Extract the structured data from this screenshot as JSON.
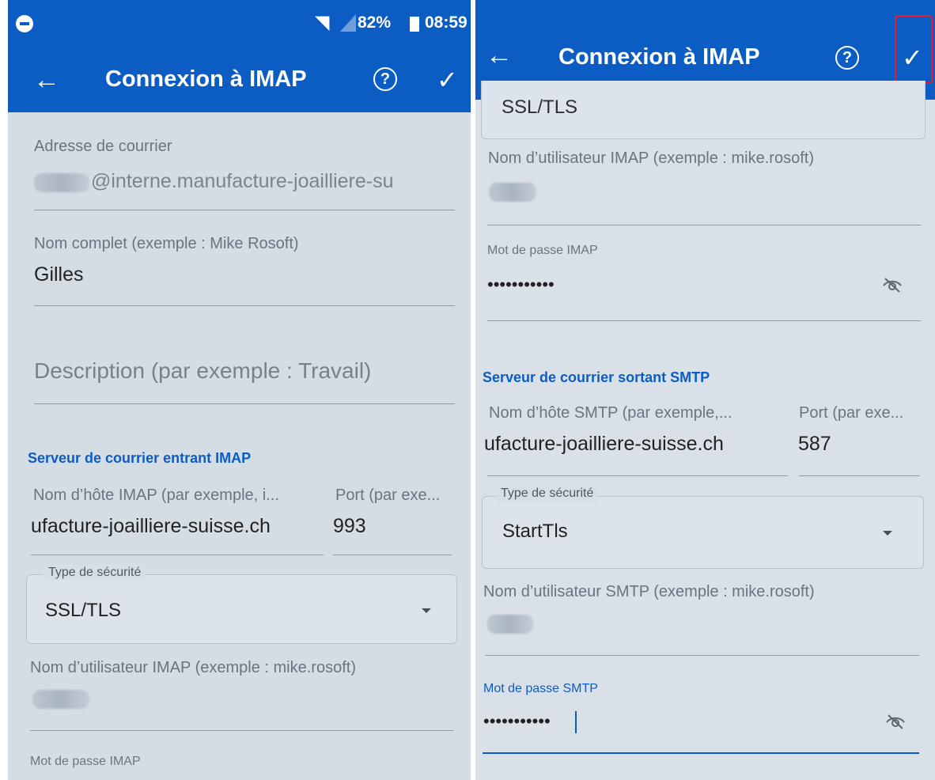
{
  "left": {
    "status": {
      "battery": "82%",
      "time": "08:59"
    },
    "header": {
      "title": "Connexion à IMAP",
      "help": "?",
      "back": "←",
      "confirm": "✓"
    },
    "fields": {
      "email_label": "Adresse de courrier",
      "email_suffix": "@interne.manufacture-joailliere-su",
      "fullname_label": "Nom complet (exemple : Mike Rosoft)",
      "fullname_value": "Gilles",
      "description_placeholder": "Description (par exemple : Travail)"
    },
    "incoming": {
      "heading": "Serveur de courrier entrant IMAP",
      "host_label": "Nom d’hôte IMAP (par exemple, i...",
      "port_label": "Port (par exe...",
      "host_value": "ufacture-joailliere-suisse.ch",
      "port_value": "993",
      "security_label": "Type de sécurité",
      "security_value": "SSL/TLS",
      "username_label": "Nom d’utilisateur IMAP (exemple : mike.rosoft)",
      "password_label": "Mot de passe IMAP"
    }
  },
  "right": {
    "header": {
      "title": "Connexion à IMAP",
      "help": "?",
      "back": "←",
      "confirm": "✓"
    },
    "top_security_value": "SSL/TLS",
    "imap_username_label": "Nom d’utilisateur IMAP (exemple : mike.rosoft)",
    "imap_password_label": "Mot de passe IMAP",
    "imap_password_value": "•••••••••••",
    "outgoing": {
      "heading": "Serveur de courrier sortant SMTP",
      "host_label": "Nom d’hôte SMTP (par exemple,...",
      "port_label": "Port (par exe...",
      "host_value": "ufacture-joailliere-suisse.ch",
      "port_value": "587",
      "security_label": "Type de sécurité",
      "security_value": "StartTls",
      "username_label": "Nom d’utilisateur SMTP (exemple : mike.rosoft)",
      "password_label": "Mot de passe SMTP",
      "password_value": "•••••••••••"
    }
  },
  "colors": {
    "brand_blue": "#0b5dc4",
    "highlight_red": "#e51b2f"
  }
}
